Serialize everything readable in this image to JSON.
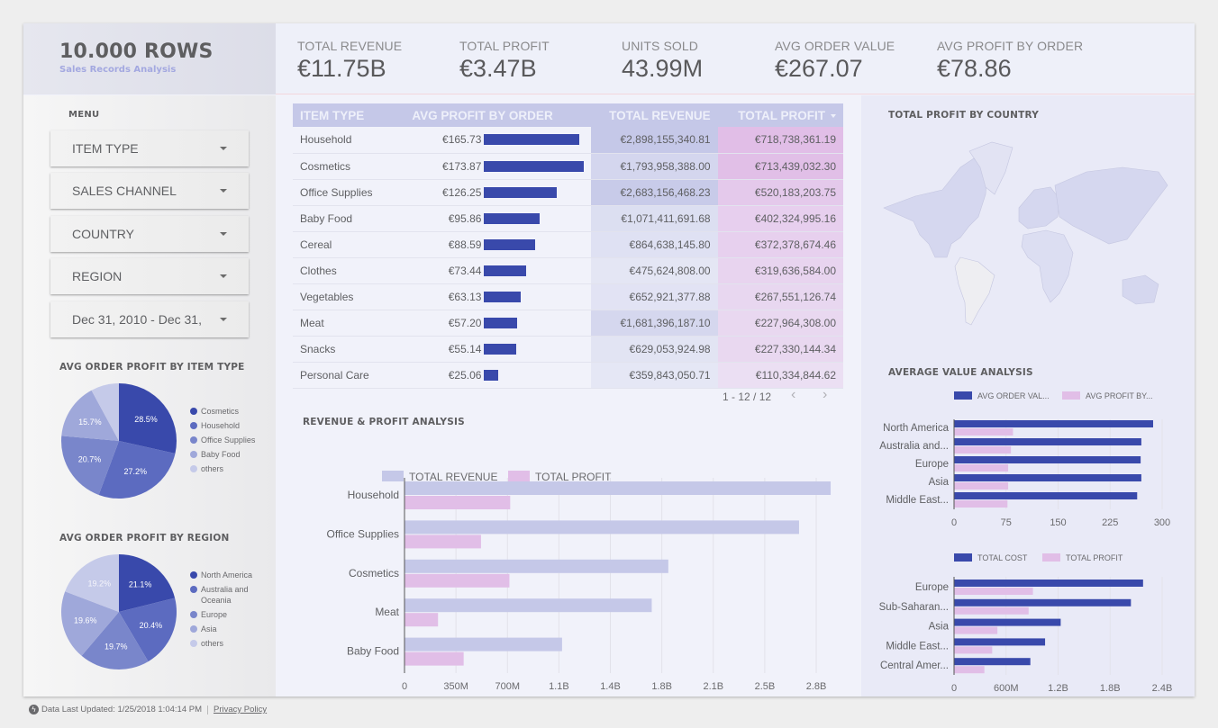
{
  "header": {
    "title": "10.000 ROWS",
    "subtitle": "Sales Records Analysis",
    "kpis": [
      {
        "label": "TOTAL REVENUE",
        "value": "€11.75B"
      },
      {
        "label": "TOTAL PROFIT",
        "value": "€3.47B"
      },
      {
        "label": "UNITS SOLD",
        "value": "43.99M"
      },
      {
        "label": "AVG ORDER VALUE",
        "value": "€267.07"
      },
      {
        "label": "AVG PROFIT BY ORDER",
        "value": "€78.86"
      }
    ]
  },
  "sidebar": {
    "menu_label": "MENU",
    "filters": [
      {
        "label": "ITEM TYPE",
        "icon": "caret-down-icon"
      },
      {
        "label": "SALES CHANNEL",
        "icon": "caret-down-icon"
      },
      {
        "label": "COUNTRY",
        "icon": "caret-down-icon"
      },
      {
        "label": "REGION",
        "icon": "caret-down-icon"
      },
      {
        "label": "Dec 31, 2010 - Dec 31,",
        "icon": "caret-down-icon"
      }
    ]
  },
  "colors": {
    "primary": "#3949ab",
    "revenue": "#c5c8e8",
    "profit": "#e1bee7",
    "pie": [
      "#3949ab",
      "#5c6bc0",
      "#7986cb",
      "#9fa8da",
      "#c5cae9"
    ]
  },
  "table": {
    "columns": [
      "ITEM TYPE",
      "AVG PROFIT BY ORDER",
      "TOTAL REVENUE",
      "TOTAL PROFIT"
    ],
    "sort_icon": "sort-desc-icon",
    "rows": [
      {
        "item": "Household",
        "avg_profit": "€165.73",
        "avg_profit_num": 165.73,
        "revenue": "€2,898,155,340.81",
        "revenue_num": 2898155340.81,
        "profit": "€718,738,361.19",
        "profit_num": 718738361.19
      },
      {
        "item": "Cosmetics",
        "avg_profit": "€173.87",
        "avg_profit_num": 173.87,
        "revenue": "€1,793,958,388.00",
        "revenue_num": 1793958388.0,
        "profit": "€713,439,032.30",
        "profit_num": 713439032.3
      },
      {
        "item": "Office Supplies",
        "avg_profit": "€126.25",
        "avg_profit_num": 126.25,
        "revenue": "€2,683,156,468.23",
        "revenue_num": 2683156468.23,
        "profit": "€520,183,203.75",
        "profit_num": 520183203.75
      },
      {
        "item": "Baby Food",
        "avg_profit": "€95.86",
        "avg_profit_num": 95.86,
        "revenue": "€1,071,411,691.68",
        "revenue_num": 1071411691.68,
        "profit": "€402,324,995.16",
        "profit_num": 402324995.16
      },
      {
        "item": "Cereal",
        "avg_profit": "€88.59",
        "avg_profit_num": 88.59,
        "revenue": "€864,638,145.80",
        "revenue_num": 864638145.8,
        "profit": "€372,378,674.46",
        "profit_num": 372378674.46
      },
      {
        "item": "Clothes",
        "avg_profit": "€73.44",
        "avg_profit_num": 73.44,
        "revenue": "€475,624,808.00",
        "revenue_num": 475624808.0,
        "profit": "€319,636,584.00",
        "profit_num": 319636584.0
      },
      {
        "item": "Vegetables",
        "avg_profit": "€63.13",
        "avg_profit_num": 63.13,
        "revenue": "€652,921,377.88",
        "revenue_num": 652921377.88,
        "profit": "€267,551,126.74",
        "profit_num": 267551126.74
      },
      {
        "item": "Meat",
        "avg_profit": "€57.20",
        "avg_profit_num": 57.2,
        "revenue": "€1,681,396,187.10",
        "revenue_num": 1681396187.1,
        "profit": "€227,964,308.00",
        "profit_num": 227964308.0
      },
      {
        "item": "Snacks",
        "avg_profit": "€55.14",
        "avg_profit_num": 55.14,
        "revenue": "€629,053,924.98",
        "revenue_num": 629053924.98,
        "profit": "€227,330,144.34",
        "profit_num": 227330144.34
      },
      {
        "item": "Personal Care",
        "avg_profit": "€25.06",
        "avg_profit_num": 25.06,
        "revenue": "€359,843,050.71",
        "revenue_num": 359843050.71,
        "profit": "€110,334,844.62",
        "profit_num": 110334844.62
      }
    ],
    "pagination": "1 - 12 / 12",
    "prev_icon": "chevron-left-icon",
    "next_icon": "chevron-right-icon"
  },
  "chart_data": [
    {
      "id": "pie-item-type",
      "type": "pie",
      "title": "AVG ORDER PROFIT BY ITEM TYPE",
      "labels": [
        "Cosmetics",
        "Household",
        "Office Supplies",
        "Baby Food",
        "others"
      ],
      "values": [
        28.5,
        27.2,
        20.7,
        15.7,
        7.9
      ],
      "value_labels": [
        "28.5%",
        "27.2%",
        "20.7%",
        "15.7%",
        ""
      ],
      "legend": "right"
    },
    {
      "id": "pie-region",
      "type": "pie",
      "title": "AVG ORDER PROFIT BY REGION",
      "labels": [
        "North America",
        "Australia and Oceania",
        "Europe",
        "Asia",
        "others"
      ],
      "values": [
        21.1,
        20.4,
        19.7,
        19.6,
        19.2
      ],
      "value_labels": [
        "21.1%",
        "20.4%",
        "19.7%",
        "19.6%",
        "19.2%"
      ],
      "legend": "right"
    },
    {
      "id": "bar-revenue-profit",
      "type": "bar",
      "orientation": "horizontal",
      "title": "REVENUE & PROFIT ANALYSIS",
      "categories": [
        "Household",
        "Office Supplies",
        "Cosmetics",
        "Meat",
        "Baby Food"
      ],
      "series": [
        {
          "name": "TOTAL REVENUE",
          "values": [
            2898155340.81,
            2683156468.23,
            1793958388.0,
            1681396187.1,
            1071411691.68
          ]
        },
        {
          "name": "TOTAL PROFIT",
          "values": [
            718738361.19,
            520183203.75,
            713439032.3,
            227964308.0,
            402324995.16
          ]
        }
      ],
      "xlim": [
        0,
        3100000000
      ],
      "xticks": [
        0,
        350000000,
        700000000,
        1050000000,
        1400000000,
        1750000000,
        2100000000,
        2450000000,
        2800000000
      ],
      "xtick_labels": [
        "0",
        "350M",
        "700M",
        "1.1B",
        "1.4B",
        "1.8B",
        "2.1B",
        "2.5B",
        "2.8B"
      ],
      "grid": true,
      "legend": "top"
    },
    {
      "id": "map-profit-country",
      "type": "heatmap",
      "title": "TOTAL PROFIT BY COUNTRY",
      "note": "world choropleth map"
    },
    {
      "id": "bar-avg-value",
      "type": "bar",
      "orientation": "horizontal",
      "title": "AVERAGE VALUE ANALYSIS",
      "categories": [
        "North America",
        "Australia and...",
        "Europe",
        "Asia",
        "Middle East..."
      ],
      "series": [
        {
          "name": "AVG ORDER VAL...",
          "values": [
            287,
            270,
            269,
            270,
            264
          ]
        },
        {
          "name": "AVG PROFIT BY...",
          "values": [
            85,
            82,
            78,
            78,
            77
          ]
        }
      ],
      "xlim": [
        0,
        300
      ],
      "xticks": [
        0,
        75,
        150,
        225,
        300
      ],
      "xtick_labels": [
        "0",
        "75",
        "150",
        "225",
        "300"
      ],
      "grid": true,
      "legend": "top"
    },
    {
      "id": "bar-cost-profit",
      "type": "bar",
      "orientation": "horizontal",
      "title": "",
      "categories": [
        "Europe",
        "Sub-Saharan...",
        "Asia",
        "Middle East...",
        "Central Amer..."
      ],
      "series": [
        {
          "name": "TOTAL COST",
          "values": [
            2180000000,
            2040000000,
            1230000000,
            1050000000,
            880000000
          ]
        },
        {
          "name": "TOTAL PROFIT",
          "values": [
            910000000,
            860000000,
            500000000,
            440000000,
            350000000
          ]
        }
      ],
      "xlim": [
        0,
        2400000000
      ],
      "xticks": [
        0,
        600000000,
        1200000000,
        1800000000,
        2400000000
      ],
      "xtick_labels": [
        "0",
        "600M",
        "1.2B",
        "1.8B",
        "2.4B"
      ],
      "grid": true,
      "legend": "top"
    }
  ],
  "footer": {
    "icon": "bolt-icon",
    "updated": "Data Last Updated: 1/25/2018 1:04:14 PM",
    "privacy": "Privacy Policy"
  }
}
